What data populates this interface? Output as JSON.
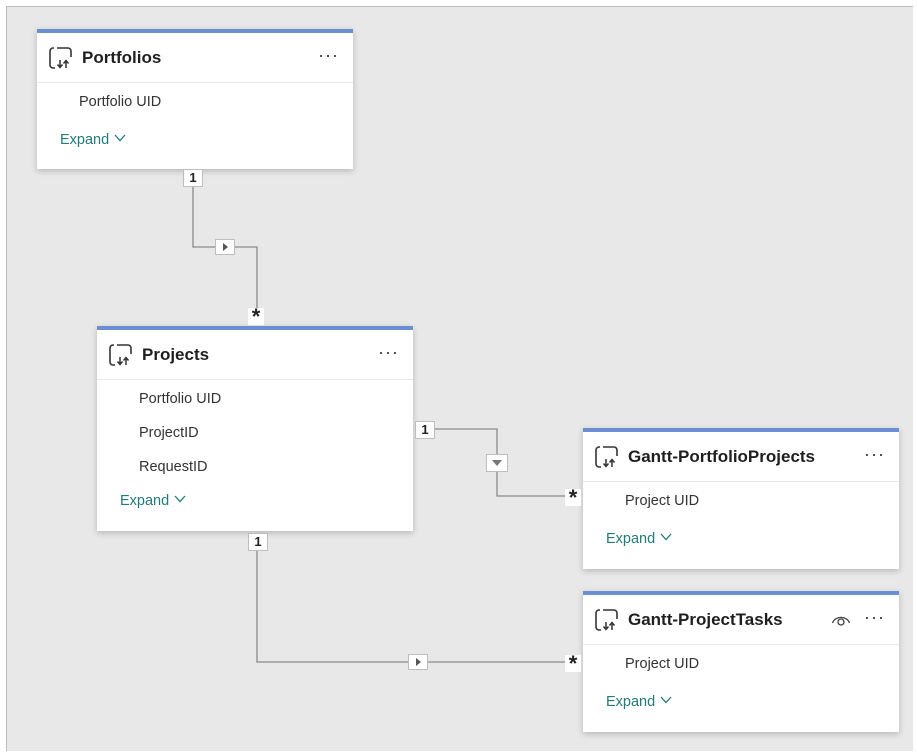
{
  "tables": {
    "portfolios": {
      "title": "Portfolios",
      "more": "···",
      "fields": [
        "Portfolio UID"
      ],
      "expand": "Expand"
    },
    "projects": {
      "title": "Projects",
      "more": "···",
      "fields": [
        "Portfolio UID",
        "ProjectID",
        "RequestID"
      ],
      "expand": "Expand"
    },
    "gantt_portfolio_projects": {
      "title": "Gantt-PortfolioProjects",
      "more": "···",
      "fields": [
        "Project UID"
      ],
      "expand": "Expand"
    },
    "gantt_project_tasks": {
      "title": "Gantt-ProjectTasks",
      "more": "···",
      "fields": [
        "Project UID"
      ],
      "expand": "Expand",
      "hidden_icon": "eye-icon"
    }
  },
  "relationships": [
    {
      "from": "Portfolios",
      "to": "Projects",
      "from_cardinality": "1",
      "to_cardinality": "*",
      "direction": "single"
    },
    {
      "from": "Projects",
      "to": "Gantt-PortfolioProjects",
      "from_cardinality": "1",
      "to_cardinality": "*",
      "direction": "single"
    },
    {
      "from": "Projects",
      "to": "Gantt-ProjectTasks",
      "from_cardinality": "1",
      "to_cardinality": "*",
      "direction": "single"
    }
  ],
  "colors": {
    "header_accent": "#6b8fd0",
    "expand_link": "#227a7a",
    "canvas": "#e8e8e8"
  }
}
